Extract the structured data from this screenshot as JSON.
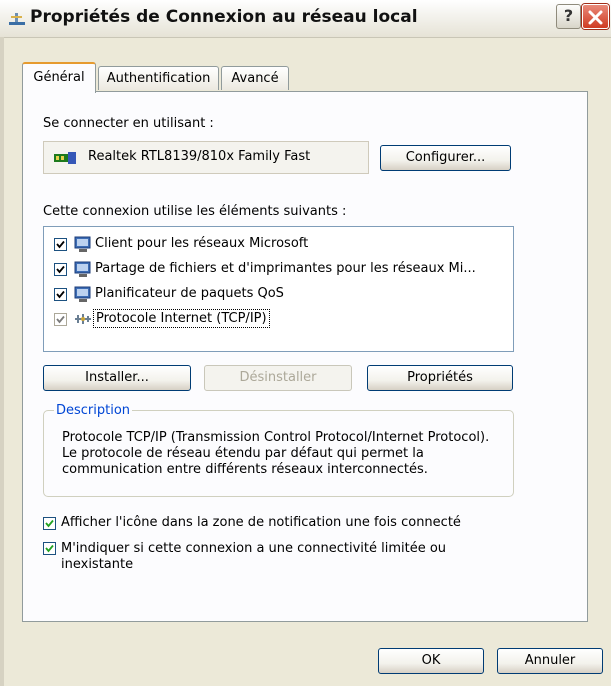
{
  "window": {
    "title": "Propriétés de Connexion au réseau local",
    "help_label": "?"
  },
  "tabs": [
    {
      "label": "Général",
      "active": true
    },
    {
      "label": "Authentification",
      "active": false
    },
    {
      "label": "Avancé",
      "active": false
    }
  ],
  "general": {
    "connect_using_label": "Se connecter en utilisant :",
    "adapter_name": "Realtek RTL8139/810x Family Fast",
    "configure_button": "Configurer...",
    "components_label": "Cette connexion utilise les éléments suivants :",
    "components": [
      {
        "label": "Client pour les réseaux Microsoft",
        "checked": true,
        "icon": "network-client-icon"
      },
      {
        "label": "Partage de fichiers et d'imprimantes pour les réseaux Mi...",
        "checked": true,
        "icon": "file-printer-sharing-icon"
      },
      {
        "label": "Planificateur de paquets QoS",
        "checked": true,
        "icon": "qos-scheduler-icon"
      },
      {
        "label": "Protocole Internet (TCP/IP)",
        "checked": true,
        "icon": "protocol-icon",
        "selected": true
      }
    ],
    "install_button": "Installer...",
    "uninstall_button": "Désinstaller",
    "properties_button": "Propriétés",
    "description_title": "Description",
    "description_text": "Protocole TCP/IP (Transmission Control Protocol/Internet Protocol). Le protocole de réseau étendu par défaut qui permet la communication entre différents réseaux interconnectés.",
    "notify_checkbox": {
      "label": "Afficher l'icône dans la zone de notification une fois connecté",
      "checked": true
    },
    "limited_checkbox": {
      "label": "M'indiquer si cette connexion a une connectivité limitée ou inexistante",
      "checked": true
    }
  },
  "footer": {
    "ok_button": "OK",
    "cancel_button": "Annuler"
  },
  "colors": {
    "accent_tab": "#e69b2f",
    "group_title": "#0046d5",
    "check": "#21a121"
  }
}
